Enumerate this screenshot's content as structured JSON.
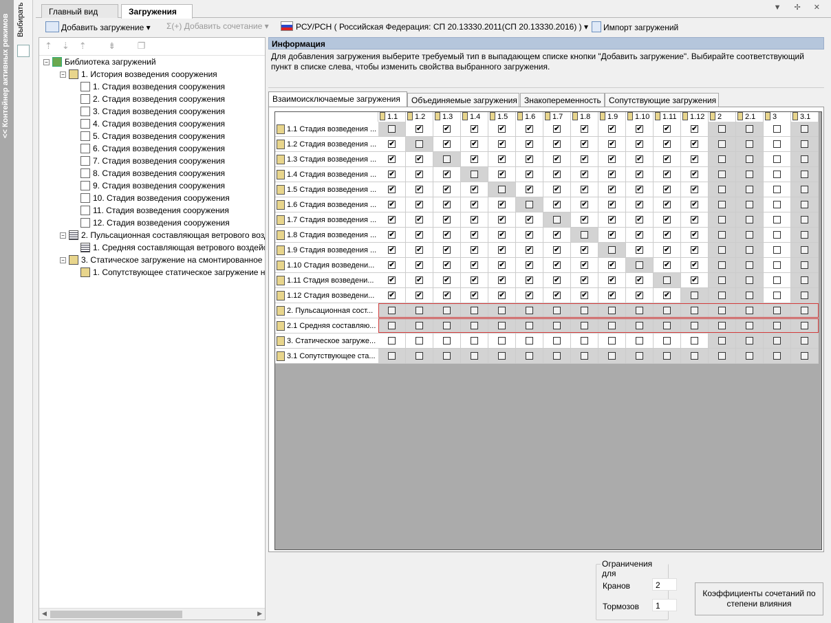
{
  "side": {
    "active_modes_label": "<< Контейнер активных режимов",
    "select_label": "Выбирать"
  },
  "doc_tabs": [
    {
      "label": "Главный вид"
    },
    {
      "label": "Загружения"
    }
  ],
  "toolbar": {
    "add_load": "Добавить загружение",
    "add_combination": "Добавить сочетание",
    "norm": "РСУ/РСН ( Российская Федерация: СП 20.13330.2011(СП 20.13330.2016) )",
    "import": "Импорт загружений"
  },
  "tree": {
    "root": "Библиотека загружений",
    "items": [
      {
        "label": "1. История возведения сооружения"
      },
      {
        "label": "1. Стадия возведения сооружения"
      },
      {
        "label": "2. Стадия возведения сооружения"
      },
      {
        "label": "3. Стадия возведения сооружения"
      },
      {
        "label": "4. Стадия возведения сооружения"
      },
      {
        "label": "5. Стадия возведения сооружения"
      },
      {
        "label": "6. Стадия возведения сооружения"
      },
      {
        "label": "7. Стадия возведения сооружения"
      },
      {
        "label": "8. Стадия возведения сооружения"
      },
      {
        "label": "9. Стадия возведения сооружения"
      },
      {
        "label": "10. Стадия возведения сооружения"
      },
      {
        "label": "11. Стадия возведения сооружения"
      },
      {
        "label": "12. Стадия возведения сооружения"
      },
      {
        "label": "2. Пульсационная составляющая ветрового возд"
      },
      {
        "label": "1. Средняя составляющая ветрового воздейс"
      },
      {
        "label": "3. Статическое загружение на смонтированное"
      },
      {
        "label": "1. Сопутствующее статическое загружение н"
      }
    ]
  },
  "info": {
    "title": "Информация",
    "text": "Для добавления загружения выберите требуемый тип в выпадающем списке кнопки \"Добавить загружение\". Выбирайте соответствующий пункт в списке слева, чтобы изменить свойства выбранного загружения."
  },
  "content_tabs": [
    {
      "label": "Взаимоисключаемые загружения"
    },
    {
      "label": "Объединяемые загружения"
    },
    {
      "label": "Знакопеременность"
    },
    {
      "label": "Сопутствующие загружения"
    }
  ],
  "grid": {
    "columns": [
      "1.1",
      "1.2",
      "1.3",
      "1.4",
      "1.5",
      "1.6",
      "1.7",
      "1.8",
      "1.9",
      "1.10",
      "1.11",
      "1.12",
      "2",
      "2.1",
      "3",
      "3.1"
    ],
    "rows": [
      {
        "label": "1.1  Стадия возведения ..."
      },
      {
        "label": "1.2  Стадия возведения ..."
      },
      {
        "label": "1.3  Стадия возведения ..."
      },
      {
        "label": "1.4  Стадия возведения ..."
      },
      {
        "label": "1.5  Стадия возведения ..."
      },
      {
        "label": "1.6  Стадия возведения ..."
      },
      {
        "label": "1.7  Стадия возведения ..."
      },
      {
        "label": "1.8  Стадия возведения ..."
      },
      {
        "label": "1.9  Стадия возведения ..."
      },
      {
        "label": "1.10  Стадия возведени..."
      },
      {
        "label": "1.11  Стадия возведени..."
      },
      {
        "label": "1.12  Стадия возведени..."
      },
      {
        "label": "2.  Пульсационная сост..."
      },
      {
        "label": "2.1  Средняя составляю..."
      },
      {
        "label": "3.  Статическое загруже..."
      },
      {
        "label": "3.1  Сопутствующее ста..."
      }
    ],
    "checked_rule": "rows 1-12 x columns 1.1-1.12 checked except diagonal; all others unchecked"
  },
  "limits": {
    "title": "Ограничения для",
    "cranes_label": "Кранов",
    "cranes_value": "2",
    "brakes_label": "Тормозов",
    "brakes_value": "1"
  },
  "coef_button": "Коэффициенты сочетаний по степени влияния"
}
